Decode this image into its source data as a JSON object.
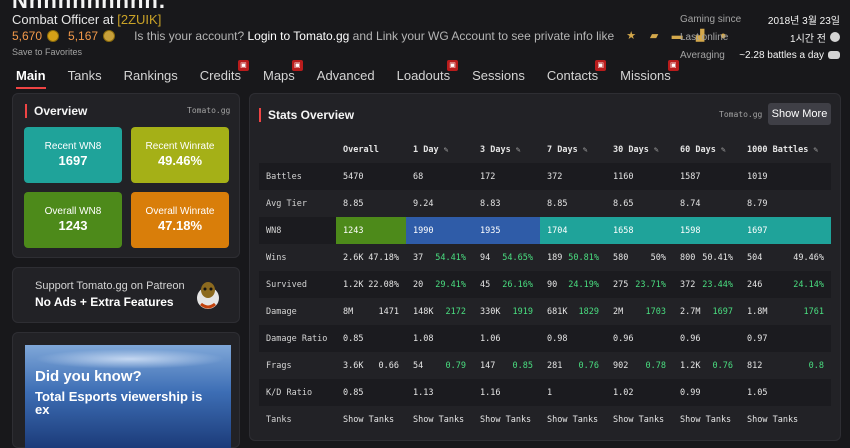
{
  "header": {
    "player_name_partial": "Nnnnnnnnnn.",
    "rank": "Combat Officer at",
    "clan": "[2ZUIK]",
    "credits_value": "5,670",
    "gold_value": "5,167",
    "claim_prefix": "Is this your account?",
    "claim_link": "Login to Tomato.gg",
    "claim_suffix": "and Link your WG Account to see private info like",
    "save_favorites": "Save to Favorites",
    "gaming_since_label": "Gaming since",
    "gaming_since_value": "2018년 3월 23일",
    "last_online_label": "Last online",
    "last_online_value": "1시간 전",
    "averaging_label": "Averaging",
    "averaging_value": "~2.28 battles a day"
  },
  "nav": [
    {
      "label": "Main",
      "active": true,
      "locked": false
    },
    {
      "label": "Tanks",
      "active": false,
      "locked": false
    },
    {
      "label": "Rankings",
      "active": false,
      "locked": false
    },
    {
      "label": "Credits",
      "active": false,
      "locked": true
    },
    {
      "label": "Maps",
      "active": false,
      "locked": true
    },
    {
      "label": "Advanced",
      "active": false,
      "locked": false
    },
    {
      "label": "Loadouts",
      "active": false,
      "locked": true
    },
    {
      "label": "Sessions",
      "active": false,
      "locked": false
    },
    {
      "label": "Contacts",
      "active": false,
      "locked": true
    },
    {
      "label": "Missions",
      "active": false,
      "locked": true
    }
  ],
  "overview": {
    "title": "Overview",
    "source": "Tomato.gg",
    "tiles": [
      {
        "label": "Recent WN8",
        "value": "1697",
        "color": "#1fa39a"
      },
      {
        "label": "Recent Winrate",
        "value": "49.46%",
        "color": "#a5b017"
      },
      {
        "label": "Overall WN8",
        "value": "1243",
        "color": "#4d8a1a"
      },
      {
        "label": "Overall Winrate",
        "value": "47.18%",
        "color": "#d97e0a"
      }
    ]
  },
  "patreon": {
    "line1": "Support Tomato.gg on Patreon",
    "line2": "No Ads + Extra Features"
  },
  "ad": {
    "headline": "Did you know?",
    "text": "Total Esports viewership is ex"
  },
  "stats": {
    "title": "Stats Overview",
    "source": "Tomato.gg",
    "show_more": "Show More",
    "columns": [
      "Overall",
      "1 Day",
      "3 Days",
      "7 Days",
      "30 Days",
      "60 Days",
      "1000 Battles"
    ],
    "rows": {
      "battles": {
        "label": "Battles",
        "cells": [
          "5470",
          "68",
          "172",
          "372",
          "1160",
          "1587",
          "1019"
        ]
      },
      "avg_tier": {
        "label": "Avg Tier",
        "cells": [
          "8.85",
          "9.24",
          "8.83",
          "8.85",
          "8.65",
          "8.74",
          "8.79"
        ]
      },
      "wn8": {
        "label": "WN8",
        "cells": [
          "1243",
          "1990",
          "1935",
          "1704",
          "1658",
          "1598",
          "1697"
        ],
        "colors": [
          "#4d8a1a",
          "#2f5ca8",
          "#2f5ca8",
          "#1fa39a",
          "#1fa39a",
          "#1fa39a",
          "#1fa39a"
        ]
      },
      "wins": {
        "label": "Wins",
        "cells": [
          [
            "2.6K",
            "47.18%"
          ],
          [
            "37",
            "54.41%"
          ],
          [
            "94",
            "54.65%"
          ],
          [
            "189",
            "50.81%"
          ],
          [
            "580",
            "50%"
          ],
          [
            "800",
            "50.41%"
          ],
          [
            "504",
            "49.46%"
          ]
        ]
      },
      "survived": {
        "label": "Survived",
        "cells": [
          [
            "1.2K",
            "22.08%"
          ],
          [
            "20",
            "29.41%"
          ],
          [
            "45",
            "26.16%"
          ],
          [
            "90",
            "24.19%"
          ],
          [
            "275",
            "23.71%"
          ],
          [
            "372",
            "23.44%"
          ],
          [
            "246",
            "24.14%"
          ]
        ]
      },
      "damage": {
        "label": "Damage",
        "cells": [
          [
            "8M",
            "1471"
          ],
          [
            "148K",
            "2172"
          ],
          [
            "330K",
            "1919"
          ],
          [
            "681K",
            "1829"
          ],
          [
            "2M",
            "1703"
          ],
          [
            "2.7M",
            "1697"
          ],
          [
            "1.8M",
            "1761"
          ]
        ]
      },
      "damage_ratio": {
        "label": "Damage Ratio",
        "cells": [
          "0.85",
          "1.08",
          "1.06",
          "0.98",
          "0.96",
          "0.96",
          "0.97"
        ]
      },
      "frags": {
        "label": "Frags",
        "cells": [
          [
            "3.6K",
            "0.66"
          ],
          [
            "54",
            "0.79"
          ],
          [
            "147",
            "0.85"
          ],
          [
            "281",
            "0.76"
          ],
          [
            "902",
            "0.78"
          ],
          [
            "1.2K",
            "0.76"
          ],
          [
            "812",
            "0.8"
          ]
        ]
      },
      "kd_ratio": {
        "label": "K/D Ratio",
        "cells": [
          "0.85",
          "1.13",
          "1.16",
          "1",
          "1.02",
          "0.99",
          "1.05"
        ]
      },
      "tanks": {
        "label": "Tanks",
        "cell": "Show Tanks"
      }
    }
  }
}
